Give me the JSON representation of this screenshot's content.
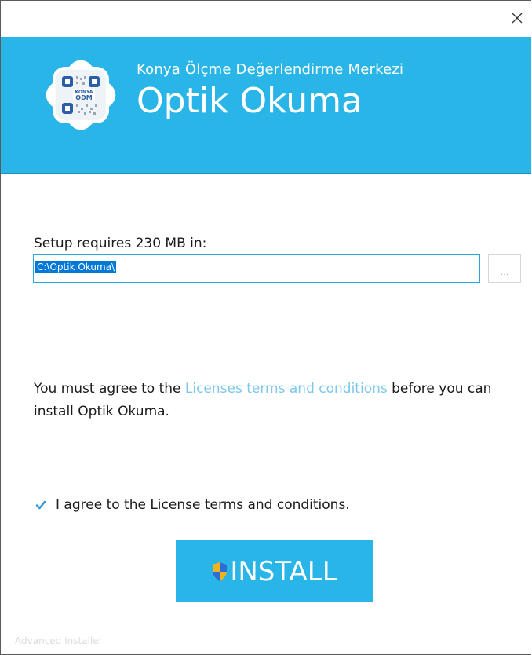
{
  "window": {
    "close_icon": "close-icon"
  },
  "banner": {
    "logo_text_top": "KONYA",
    "logo_text_bottom": "ODM",
    "subtitle": "Konya Ölçme Değerlendirme Merkezi",
    "title": "Optik Okuma",
    "color": "#29b5e8"
  },
  "location": {
    "label": "Setup requires 230 MB in:",
    "path_value": "C:\\Optik Okuma\\",
    "browse_label": "..."
  },
  "license": {
    "text_before": "You must agree to the ",
    "link_text": "Licenses terms and conditions",
    "text_after": " before you can install Optik Okuma.",
    "checkbox_checked": true,
    "checkbox_label": "I agree to the License terms and conditions."
  },
  "install": {
    "label": "INSTALL",
    "icon": "uac-shield-icon"
  },
  "footer": {
    "brand": "Advanced Installer"
  }
}
